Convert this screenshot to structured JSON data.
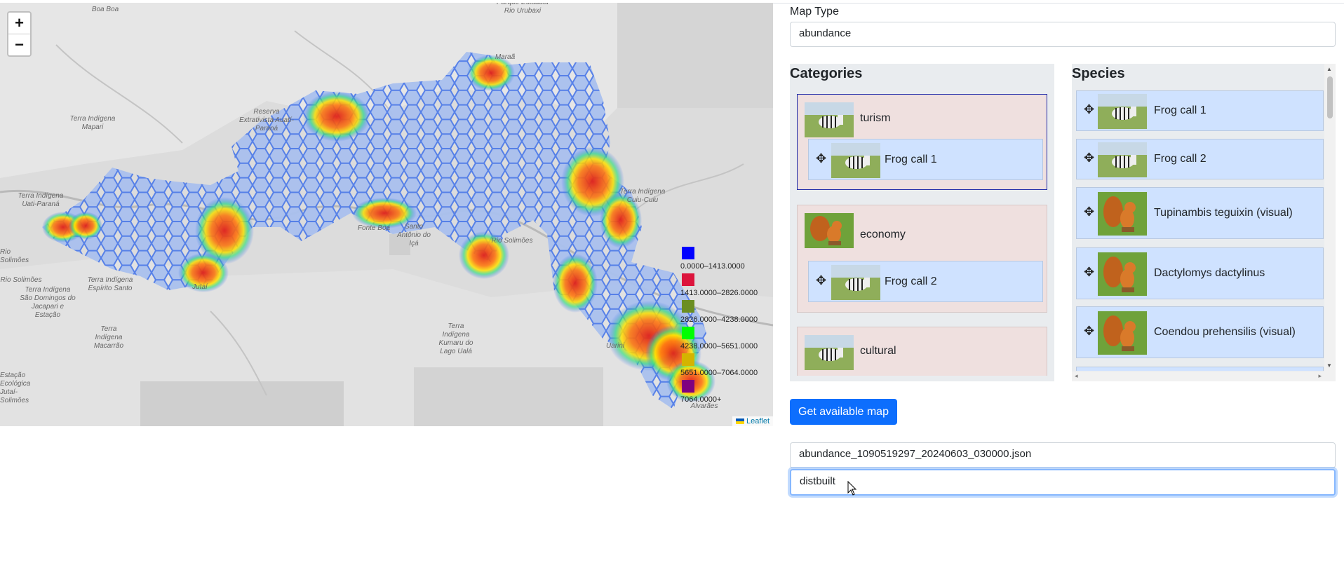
{
  "map": {
    "zoom_in": "+",
    "zoom_out": "−",
    "attribution": "Leaflet",
    "place_labels": [
      "Paraná do Boa Boa",
      "Parque Estadual Rio Urubaxi",
      "Maraã",
      "Terra Indígena Mapari",
      "Reserva Extrativista Auatí-Paraná",
      "Terra Indígena Uati-Paraná",
      "Fonte Boa",
      "Santo Antônio do Içá",
      "Terra Indígena Cuiu-Cuiu",
      "Jutaí",
      "Rio Solimões",
      "Terra Indígena Espírito Santo",
      "Terra Indígena São Domingos do Jacapari e Estação",
      "Terra Indígena Macarrão",
      "Terra Indígena Kumaru do Lago Ualá",
      "Uarini",
      "Alvarães",
      "Estação Ecológica Jutaí-Solimões",
      "Rio Solimões",
      "Rio Solimões"
    ],
    "legend": [
      {
        "color": "#0000ff",
        "label": "0.0000–1413.0000"
      },
      {
        "color": "#dc143c",
        "label": "1413.0000–2826.0000"
      },
      {
        "color": "#6b8e23",
        "label": "2826.0000–4238.0000"
      },
      {
        "color": "#00ff00",
        "label": "4238.0000–5651.0000"
      },
      {
        "color": "#d4b400",
        "label": "5651.0000–7064.0000"
      },
      {
        "color": "#800080",
        "label": "7064.0000+"
      }
    ]
  },
  "form": {
    "map_type_label": "Map Type",
    "map_type_value": "abundance",
    "categories_title": "Categories",
    "species_title": "Species",
    "get_map_button": "Get available map",
    "file_value": "abundance_1090519297_20240603_030000.json",
    "dist_value": "distbuilt"
  },
  "categories": [
    {
      "name": "turism",
      "thumb": "zebra-thumb",
      "items": [
        {
          "name": "Frog call 1",
          "thumb": "zebra-thumb"
        }
      ]
    },
    {
      "name": "economy",
      "thumb": "squirrel-thumb",
      "items": [
        {
          "name": "Frog call 2",
          "thumb": "zebra-thumb"
        }
      ]
    },
    {
      "name": "cultural",
      "thumb": "zebra-thumb",
      "items": []
    }
  ],
  "species": [
    {
      "name": "Frog call 1",
      "thumb": "zebra-thumb"
    },
    {
      "name": "Frog call 2",
      "thumb": "zebra-thumb"
    },
    {
      "name": "Tupinambis teguixin (visual)",
      "thumb": "squirrel-thumb"
    },
    {
      "name": "Dactylomys dactylinus",
      "thumb": "squirrel-thumb"
    },
    {
      "name": "Coendou prehensilis (visual)",
      "thumb": "squirrel-thumb"
    }
  ],
  "colors": {
    "accent": "#0d6efd",
    "category_bg": "#efe0df",
    "item_bg": "#cfe2ff"
  }
}
